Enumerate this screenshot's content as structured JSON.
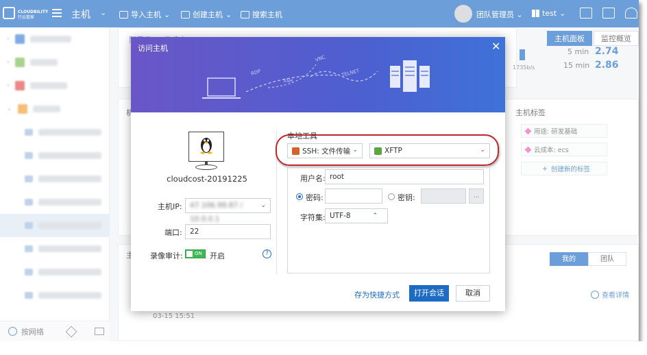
{
  "topbar": {
    "logo_name": "CLOUDBILITY",
    "logo_sub": "行云管家",
    "menu_title": "主机",
    "import_label": "导入主机",
    "create_label": "创建主机",
    "search_label": "搜索主机",
    "user_label": "团队管理员",
    "tenant_label": "test",
    "brand_color": "#1e6bc6"
  },
  "main": {
    "breadcrumb": "阿里云1 / 云成本 ... / cloudcost-20191225",
    "tab_host_panel": "主机面板",
    "tab_monitor": "监控概览",
    "load_5_label": "5 min",
    "load_5_value": "2.74",
    "load_15_label": "15 min",
    "load_15_value": "2.86",
    "net_rate": "1735b/s",
    "tags_title": "主机标签",
    "tags": [
      "用途: 研发基础",
      "云成本: ecs"
    ],
    "add_tag_label": "创建新的标签",
    "seg_mine": "我的",
    "seg_team": "团队",
    "more_label": "查看详情",
    "date_text": "03-15 15:51",
    "left_frag_1": "机",
    "left_frag_2": "主"
  },
  "sidebar": {
    "bottom_label": "按网络"
  },
  "modal": {
    "title": "访问主机",
    "hero_labels": [
      "RDP",
      "SSH",
      "VNC",
      "TELNET"
    ],
    "hostname": "cloudcost-20191225",
    "ip_label": "主机IP:",
    "ip_value": "47.106.99.87 / 10.0.0.1",
    "port_label": "端口:",
    "port_value": "22",
    "record_label": "录像审计:",
    "record_toggle": "ON",
    "record_state": "开启",
    "local_tools_title": "本地工具",
    "protocol_value": "SSH: 文件传输",
    "tool_value": "XFTP",
    "username_label": "用户名:",
    "username_value": "root",
    "password_label": "密码:",
    "key_label": "密钥:",
    "charset_label": "字符集:",
    "charset_value": "UTF-8",
    "shortcut_label": "存为快捷方式",
    "open_label": "打开会话",
    "cancel_label": "取消",
    "accent_color": "#c0262d"
  }
}
